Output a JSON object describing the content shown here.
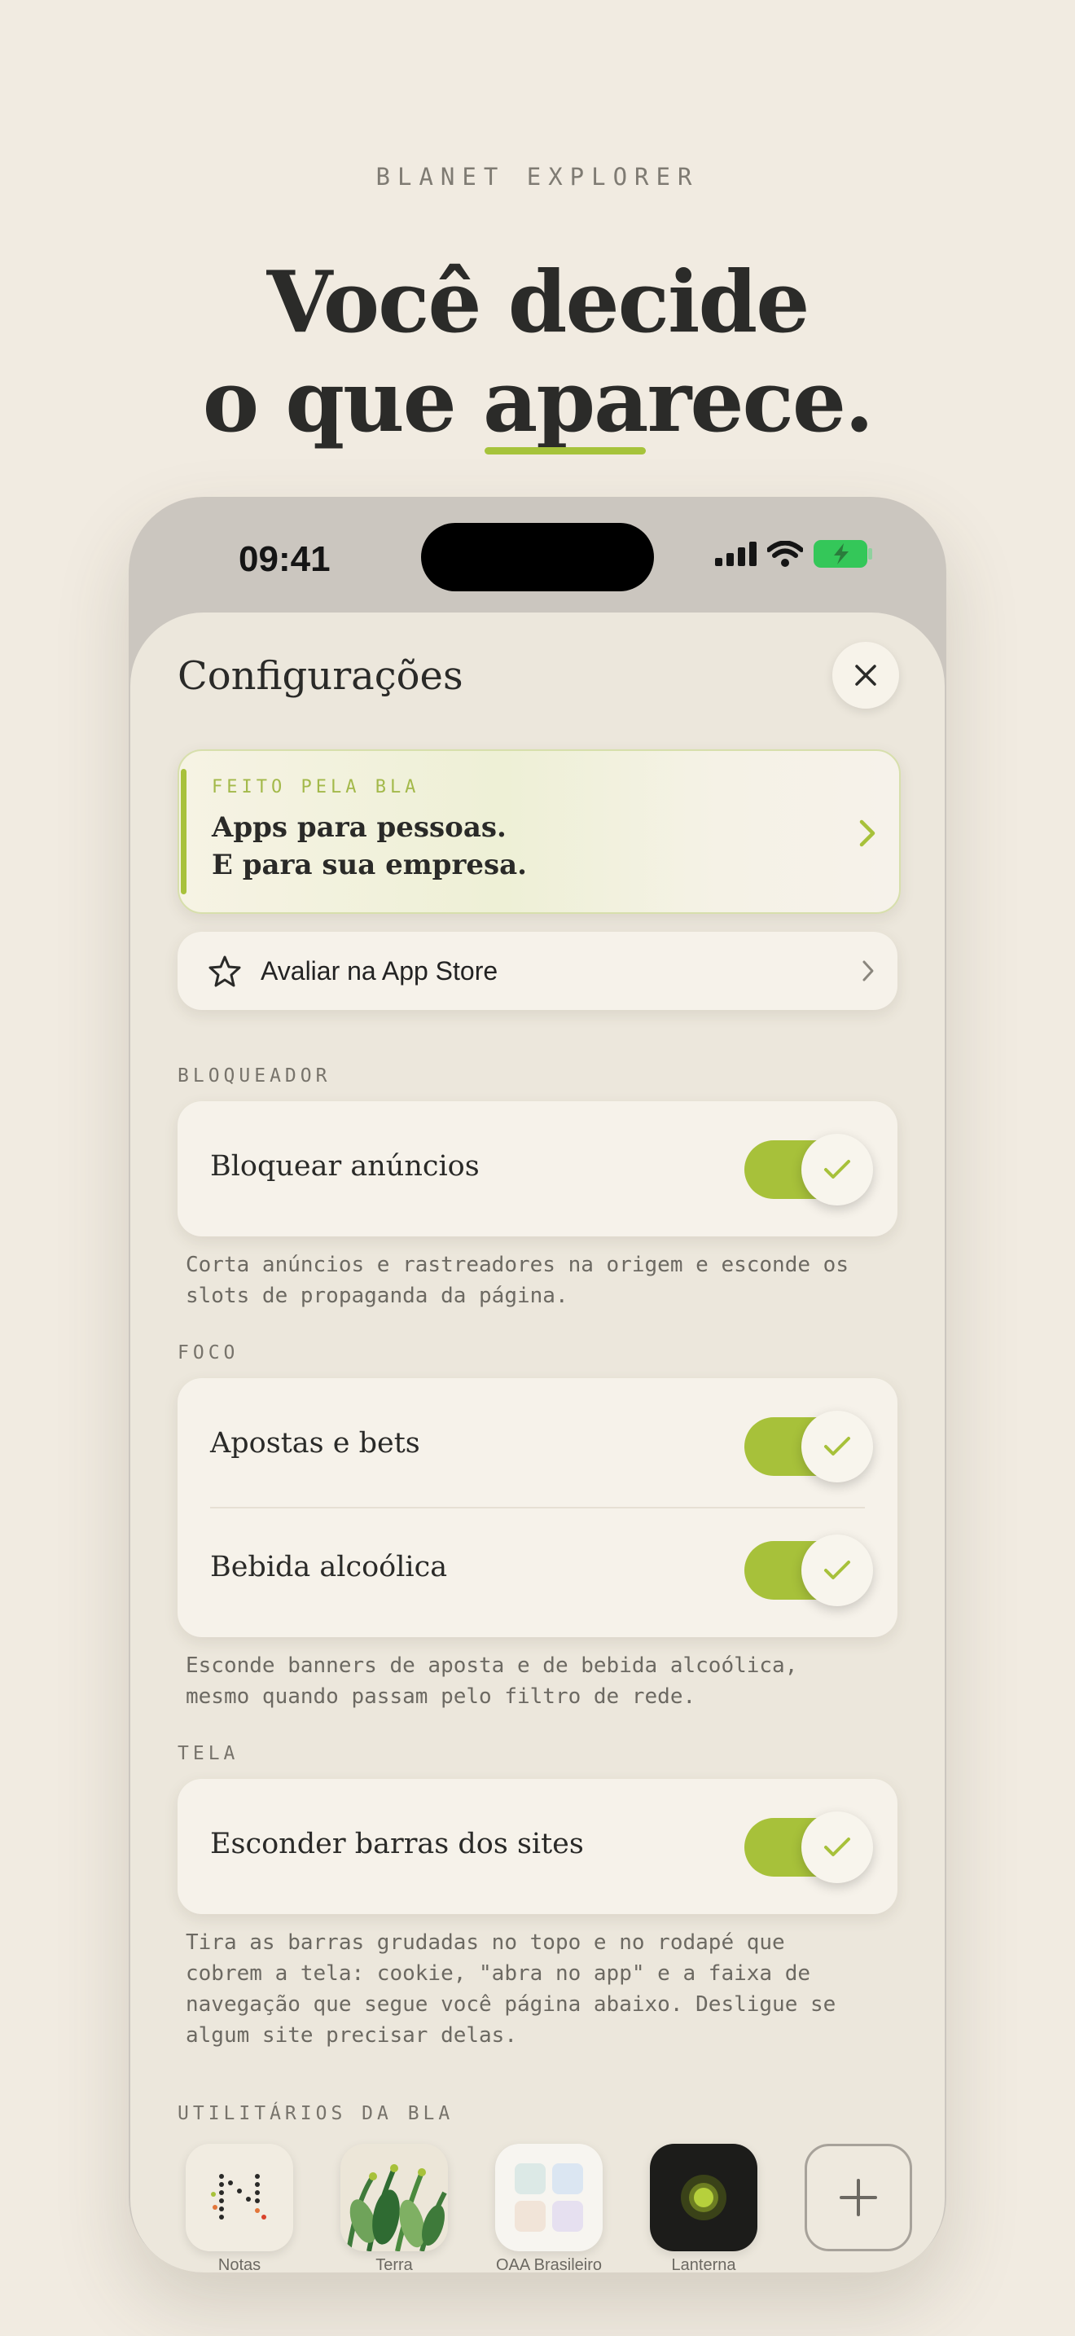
{
  "brand": "BLANET EXPLORER",
  "headline": {
    "line1": "Você decide",
    "line2_pre": "o que ",
    "line2_underlined": "apa",
    "line2_post": "rece."
  },
  "status_bar": {
    "time": "09:41"
  },
  "sheet": {
    "title": "Configurações"
  },
  "promo": {
    "eyebrow": "FEITO PELA BLA",
    "line1": "Apps para pessoas.",
    "line2": "E para sua empresa."
  },
  "rate": {
    "label": "Avaliar na App Store"
  },
  "sections": {
    "blocker": {
      "label": "BLOQUEADOR",
      "row": {
        "label": "Bloquear anúncios",
        "enabled": true
      },
      "desc_line1": "Corta anúncios e rastreadores na origem e esconde os",
      "desc_line2": "slots de propaganda da página."
    },
    "focus": {
      "label": "FOCO",
      "rows": [
        {
          "label": "Apostas e bets",
          "enabled": true
        },
        {
          "label": "Bebida alcoólica",
          "enabled": true
        }
      ],
      "desc_line1": "Esconde banners de aposta e de bebida alcoólica,",
      "desc_line2": "mesmo quando passam pelo filtro de rede."
    },
    "screen": {
      "label": "TELA",
      "row": {
        "label": "Esconder barras dos sites",
        "enabled": true
      },
      "desc_line1": "Tira as barras grudadas no topo e no rodapé que",
      "desc_line2": "cobrem a tela: cookie, \"abra no app\" e a faixa de",
      "desc_line3": "navegação que segue você página abaixo. Desligue se",
      "desc_line4": "algum site precisar delas."
    },
    "utilities": {
      "label": "UTILITÁRIOS DA BLA",
      "apps": [
        {
          "name": "Notas",
          "icon": "notes-dots-icon"
        },
        {
          "name": "Terra",
          "icon": "plants-icon"
        },
        {
          "name": "OAA Brasileiro",
          "icon": "grid-tiles-icon"
        },
        {
          "name": "Lanterna",
          "icon": "flashlight-glow-icon"
        },
        {
          "name": "",
          "icon": "plus-icon"
        }
      ]
    }
  },
  "colors": {
    "accent": "#a7c13a",
    "background": "#f1ebe1",
    "sheet": "#ece7dc",
    "card": "#f6f2ea"
  }
}
